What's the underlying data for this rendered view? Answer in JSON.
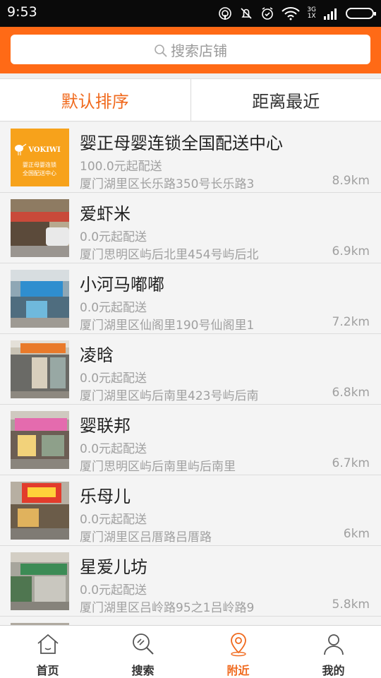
{
  "status_bar": {
    "time": "9:53",
    "network": "3G",
    "network_sub": "1X",
    "icons": [
      "hotspot-icon",
      "silent-icon",
      "alarm-icon",
      "wifi-icon",
      "signal-icon",
      "battery-icon"
    ]
  },
  "header": {
    "search_placeholder": "搜索店铺",
    "accent_color": "#ff6a16"
  },
  "sort_tabs": [
    {
      "label": "默认排序",
      "active": true
    },
    {
      "label": "距离最近",
      "active": false
    }
  ],
  "shops": [
    {
      "name": "婴正母婴连锁全国配送中心",
      "min_order": "100.0元起配送",
      "address": "厦门湖里区长乐路350号长乐路3",
      "distance": "8.9km",
      "thumb_brand": "VOKIWI",
      "thumb_line1": "婴正母婴连锁",
      "thumb_line2": "全国配送中心"
    },
    {
      "name": "爱虾米",
      "min_order": "0.0元起配送",
      "address": "厦门思明区屿后北里454号屿后北",
      "distance": "6.9km"
    },
    {
      "name": "小河马嘟嘟",
      "min_order": "0.0元起配送",
      "address": "厦门湖里区仙阁里190号仙阁里1",
      "distance": "7.2km"
    },
    {
      "name": "凌晗",
      "min_order": "0.0元起配送",
      "address": "厦门湖里区屿后南里423号屿后南",
      "distance": "6.8km"
    },
    {
      "name": "婴联邦",
      "min_order": "0.0元起配送",
      "address": "厦门思明区屿后南里屿后南里",
      "distance": "6.7km"
    },
    {
      "name": "乐母儿",
      "min_order": "0.0元起配送",
      "address": "厦门湖里区吕厝路吕厝路",
      "distance": "6km"
    },
    {
      "name": "星爱儿坊",
      "min_order": "0.0元起配送",
      "address": "厦门湖里区吕岭路95之1吕岭路9",
      "distance": "5.8km"
    }
  ],
  "bottom_nav": [
    {
      "label": "首页",
      "icon": "home-icon",
      "active": false
    },
    {
      "label": "搜索",
      "icon": "search-icon",
      "active": false
    },
    {
      "label": "附近",
      "icon": "location-pin-icon",
      "active": true
    },
    {
      "label": "我的",
      "icon": "user-icon",
      "active": false
    }
  ]
}
